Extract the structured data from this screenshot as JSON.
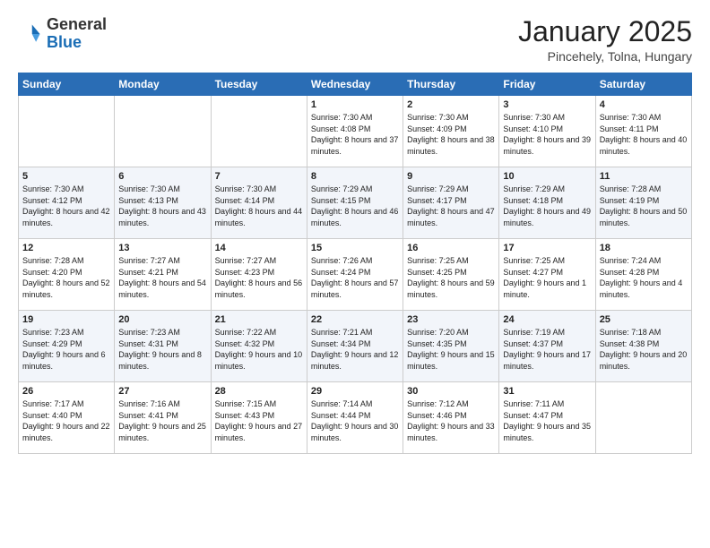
{
  "header": {
    "logo": {
      "general": "General",
      "blue": "Blue"
    },
    "title": "January 2025",
    "subtitle": "Pincehely, Tolna, Hungary"
  },
  "days_of_week": [
    "Sunday",
    "Monday",
    "Tuesday",
    "Wednesday",
    "Thursday",
    "Friday",
    "Saturday"
  ],
  "weeks": [
    [
      {
        "day": "",
        "info": ""
      },
      {
        "day": "",
        "info": ""
      },
      {
        "day": "",
        "info": ""
      },
      {
        "day": "1",
        "info": "Sunrise: 7:30 AM\nSunset: 4:08 PM\nDaylight: 8 hours and 37 minutes."
      },
      {
        "day": "2",
        "info": "Sunrise: 7:30 AM\nSunset: 4:09 PM\nDaylight: 8 hours and 38 minutes."
      },
      {
        "day": "3",
        "info": "Sunrise: 7:30 AM\nSunset: 4:10 PM\nDaylight: 8 hours and 39 minutes."
      },
      {
        "day": "4",
        "info": "Sunrise: 7:30 AM\nSunset: 4:11 PM\nDaylight: 8 hours and 40 minutes."
      }
    ],
    [
      {
        "day": "5",
        "info": "Sunrise: 7:30 AM\nSunset: 4:12 PM\nDaylight: 8 hours and 42 minutes."
      },
      {
        "day": "6",
        "info": "Sunrise: 7:30 AM\nSunset: 4:13 PM\nDaylight: 8 hours and 43 minutes."
      },
      {
        "day": "7",
        "info": "Sunrise: 7:30 AM\nSunset: 4:14 PM\nDaylight: 8 hours and 44 minutes."
      },
      {
        "day": "8",
        "info": "Sunrise: 7:29 AM\nSunset: 4:15 PM\nDaylight: 8 hours and 46 minutes."
      },
      {
        "day": "9",
        "info": "Sunrise: 7:29 AM\nSunset: 4:17 PM\nDaylight: 8 hours and 47 minutes."
      },
      {
        "day": "10",
        "info": "Sunrise: 7:29 AM\nSunset: 4:18 PM\nDaylight: 8 hours and 49 minutes."
      },
      {
        "day": "11",
        "info": "Sunrise: 7:28 AM\nSunset: 4:19 PM\nDaylight: 8 hours and 50 minutes."
      }
    ],
    [
      {
        "day": "12",
        "info": "Sunrise: 7:28 AM\nSunset: 4:20 PM\nDaylight: 8 hours and 52 minutes."
      },
      {
        "day": "13",
        "info": "Sunrise: 7:27 AM\nSunset: 4:21 PM\nDaylight: 8 hours and 54 minutes."
      },
      {
        "day": "14",
        "info": "Sunrise: 7:27 AM\nSunset: 4:23 PM\nDaylight: 8 hours and 56 minutes."
      },
      {
        "day": "15",
        "info": "Sunrise: 7:26 AM\nSunset: 4:24 PM\nDaylight: 8 hours and 57 minutes."
      },
      {
        "day": "16",
        "info": "Sunrise: 7:25 AM\nSunset: 4:25 PM\nDaylight: 8 hours and 59 minutes."
      },
      {
        "day": "17",
        "info": "Sunrise: 7:25 AM\nSunset: 4:27 PM\nDaylight: 9 hours and 1 minute."
      },
      {
        "day": "18",
        "info": "Sunrise: 7:24 AM\nSunset: 4:28 PM\nDaylight: 9 hours and 4 minutes."
      }
    ],
    [
      {
        "day": "19",
        "info": "Sunrise: 7:23 AM\nSunset: 4:29 PM\nDaylight: 9 hours and 6 minutes."
      },
      {
        "day": "20",
        "info": "Sunrise: 7:23 AM\nSunset: 4:31 PM\nDaylight: 9 hours and 8 minutes."
      },
      {
        "day": "21",
        "info": "Sunrise: 7:22 AM\nSunset: 4:32 PM\nDaylight: 9 hours and 10 minutes."
      },
      {
        "day": "22",
        "info": "Sunrise: 7:21 AM\nSunset: 4:34 PM\nDaylight: 9 hours and 12 minutes."
      },
      {
        "day": "23",
        "info": "Sunrise: 7:20 AM\nSunset: 4:35 PM\nDaylight: 9 hours and 15 minutes."
      },
      {
        "day": "24",
        "info": "Sunrise: 7:19 AM\nSunset: 4:37 PM\nDaylight: 9 hours and 17 minutes."
      },
      {
        "day": "25",
        "info": "Sunrise: 7:18 AM\nSunset: 4:38 PM\nDaylight: 9 hours and 20 minutes."
      }
    ],
    [
      {
        "day": "26",
        "info": "Sunrise: 7:17 AM\nSunset: 4:40 PM\nDaylight: 9 hours and 22 minutes."
      },
      {
        "day": "27",
        "info": "Sunrise: 7:16 AM\nSunset: 4:41 PM\nDaylight: 9 hours and 25 minutes."
      },
      {
        "day": "28",
        "info": "Sunrise: 7:15 AM\nSunset: 4:43 PM\nDaylight: 9 hours and 27 minutes."
      },
      {
        "day": "29",
        "info": "Sunrise: 7:14 AM\nSunset: 4:44 PM\nDaylight: 9 hours and 30 minutes."
      },
      {
        "day": "30",
        "info": "Sunrise: 7:12 AM\nSunset: 4:46 PM\nDaylight: 9 hours and 33 minutes."
      },
      {
        "day": "31",
        "info": "Sunrise: 7:11 AM\nSunset: 4:47 PM\nDaylight: 9 hours and 35 minutes."
      },
      {
        "day": "",
        "info": ""
      }
    ]
  ]
}
